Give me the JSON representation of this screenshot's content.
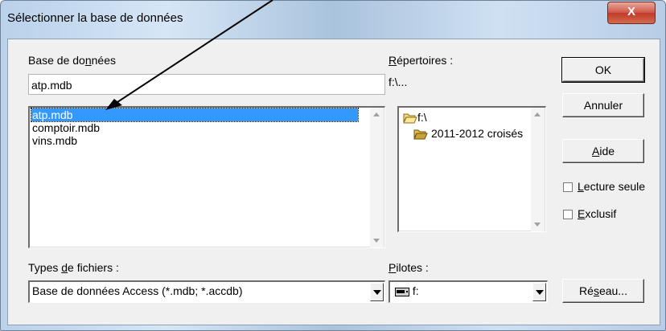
{
  "window": {
    "title": "Sélectionner la base de données",
    "close_glyph": "X"
  },
  "database": {
    "label_pre": "Base de do",
    "label_ul": "n",
    "label_post": "nées",
    "filename_value": "atp.mdb",
    "files": [
      "atp.mdb",
      "comptoir.mdb",
      "vins.mdb"
    ],
    "selected_index": 0
  },
  "directories": {
    "label_ul": "R",
    "label_post": "épertoires :",
    "current_path": "f:\\...",
    "items": [
      "f:\\",
      "2011-2012 croisés"
    ]
  },
  "file_types": {
    "label_pre": "Types ",
    "label_ul": "d",
    "label_post": "e fichiers :",
    "selected": "Base de données Access (*.mdb; *.accdb)"
  },
  "drives": {
    "label_ul": "P",
    "label_post": "ilotes :",
    "selected": "f:"
  },
  "buttons": {
    "ok": "OK",
    "cancel": "Annuler",
    "help_ul": "A",
    "help_post": "ide",
    "network_pre": "Ré",
    "network_ul": "s",
    "network_post": "eau..."
  },
  "options": {
    "readonly_ul": "L",
    "readonly_post": "ecture seule",
    "readonly_checked": false,
    "exclusive_ul": "E",
    "exclusive_post": "xclusif",
    "exclusive_checked": false
  },
  "colors": {
    "selection": "#3399ff",
    "close_button": "#c8453a"
  }
}
